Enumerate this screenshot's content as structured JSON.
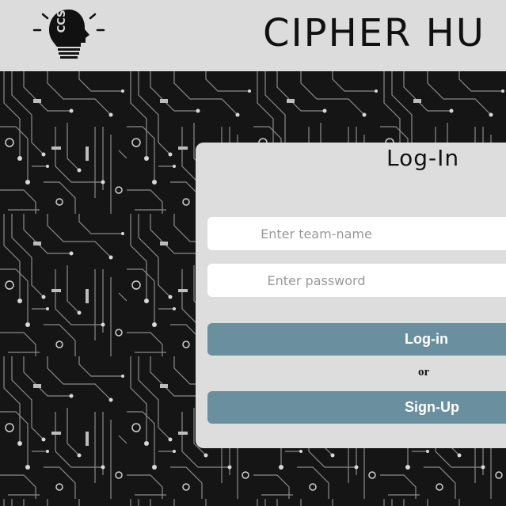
{
  "header": {
    "logo_text": "CCS",
    "title": "CIPHER HU"
  },
  "login_card": {
    "title": "Log-In",
    "team_name_placeholder": "Enter team-name",
    "password_placeholder": "Enter password",
    "login_button_label": "Log-in",
    "separator_text": "or",
    "signup_button_label": "Sign-Up"
  },
  "colors": {
    "header_bg": "#dcdcdc",
    "card_bg": "#dddddd",
    "button_bg": "#6a8f9e",
    "page_bg": "#141414"
  },
  "icons": [
    "bulb-head-logo-icon"
  ]
}
